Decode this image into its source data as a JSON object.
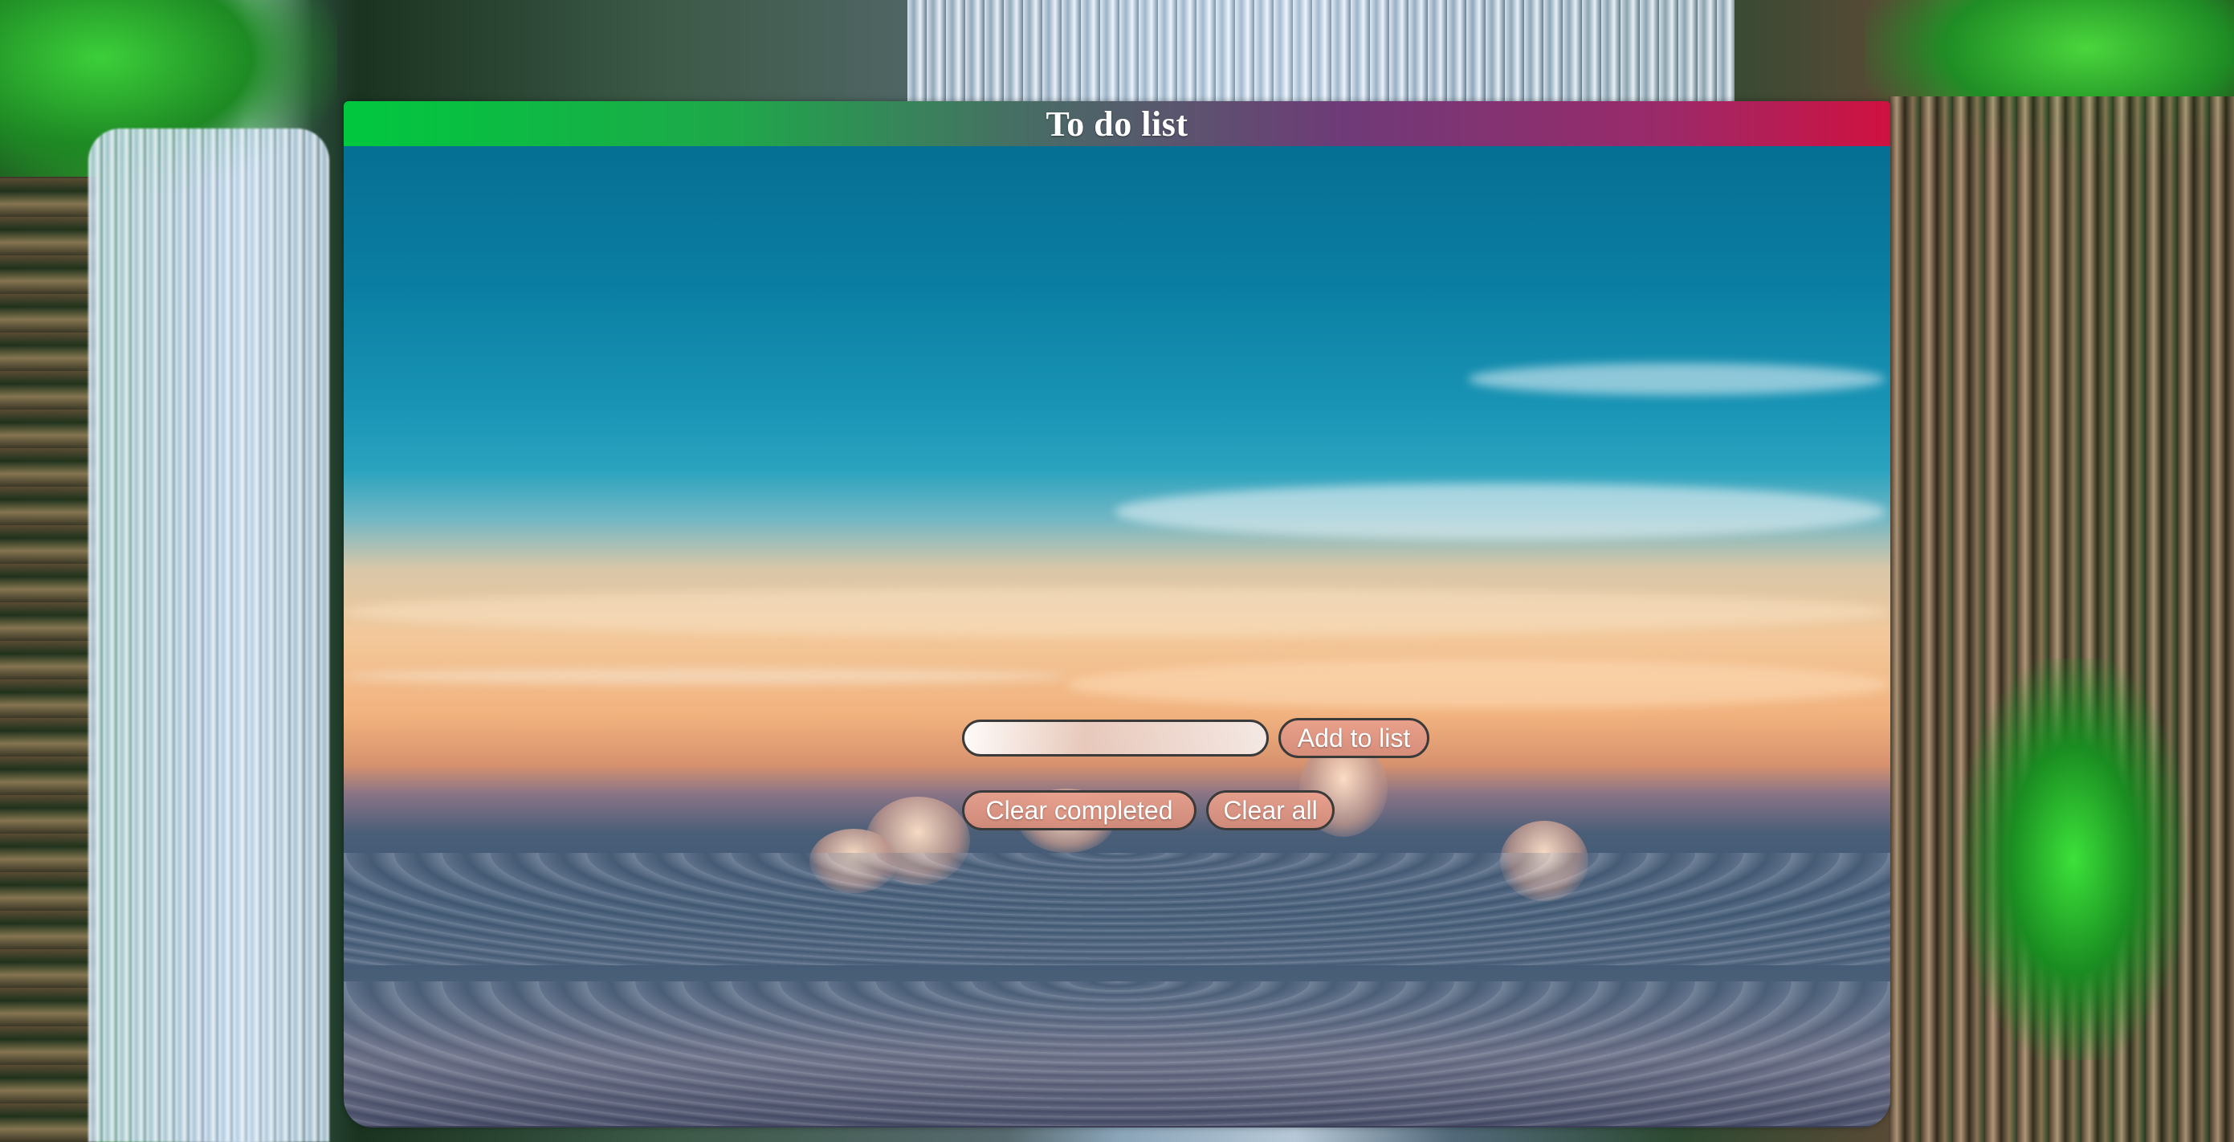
{
  "header": {
    "title": "To do list"
  },
  "form": {
    "input_value": "",
    "input_placeholder": "",
    "add_label": "Add to list"
  },
  "actions": {
    "clear_completed_label": "Clear completed",
    "clear_all_label": "Clear all"
  },
  "todo_items": [],
  "colors": {
    "header_gradient_start": "#00c83e",
    "header_gradient_end": "#d01140",
    "button_fill": "#e0967f",
    "button_border": "#3a3a3a"
  }
}
